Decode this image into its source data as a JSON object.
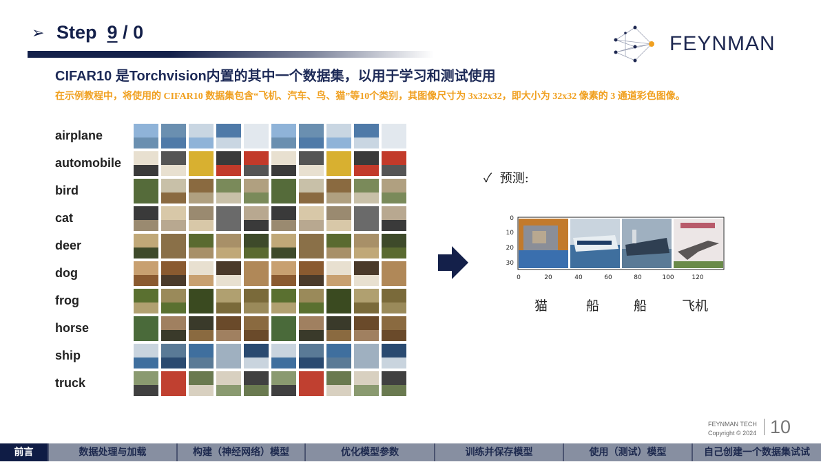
{
  "header": {
    "step_label": "Step",
    "step_num": "9",
    "step_sep": "/",
    "step_total": "0",
    "logo_text": "FEYNMAN"
  },
  "slide": {
    "title": "CIFAR10 是Torchvision内置的其中一个数据集，以用于学习和测试使用",
    "subtitle": "在示例教程中，将使用的 CIFAR10 数据集包含“飞机、汽车、鸟、猫”等10个类别，其图像尺寸为 3x32x32，即大小为 32x32 像素的 3 通道彩色图像。"
  },
  "classes": [
    "airplane",
    "automobile",
    "bird",
    "cat",
    "deer",
    "dog",
    "frog",
    "horse",
    "ship",
    "truck"
  ],
  "prediction": {
    "label": "预测:",
    "words": [
      "猫",
      "船",
      "船",
      "飞机"
    ],
    "y_ticks": [
      "0",
      "10",
      "20",
      "30"
    ],
    "x_ticks": [
      "0",
      "20",
      "40",
      "60",
      "80",
      "100",
      "120"
    ]
  },
  "footer": {
    "brand": "FEYNMAN TECH",
    "copyright": "Copyright © 2024",
    "page_number": "10"
  },
  "nav": {
    "items": [
      "前言",
      "数据处理与加载",
      "构建（神经网络）模型",
      "优化模型参数",
      "训练并保存模型",
      "使用（测试）模型",
      "自己创建一个数据集试试"
    ],
    "active_index": 0
  },
  "colors": {
    "navy": "#13204a",
    "orange": "#f0a020",
    "nav_bg": "#878fa1"
  }
}
